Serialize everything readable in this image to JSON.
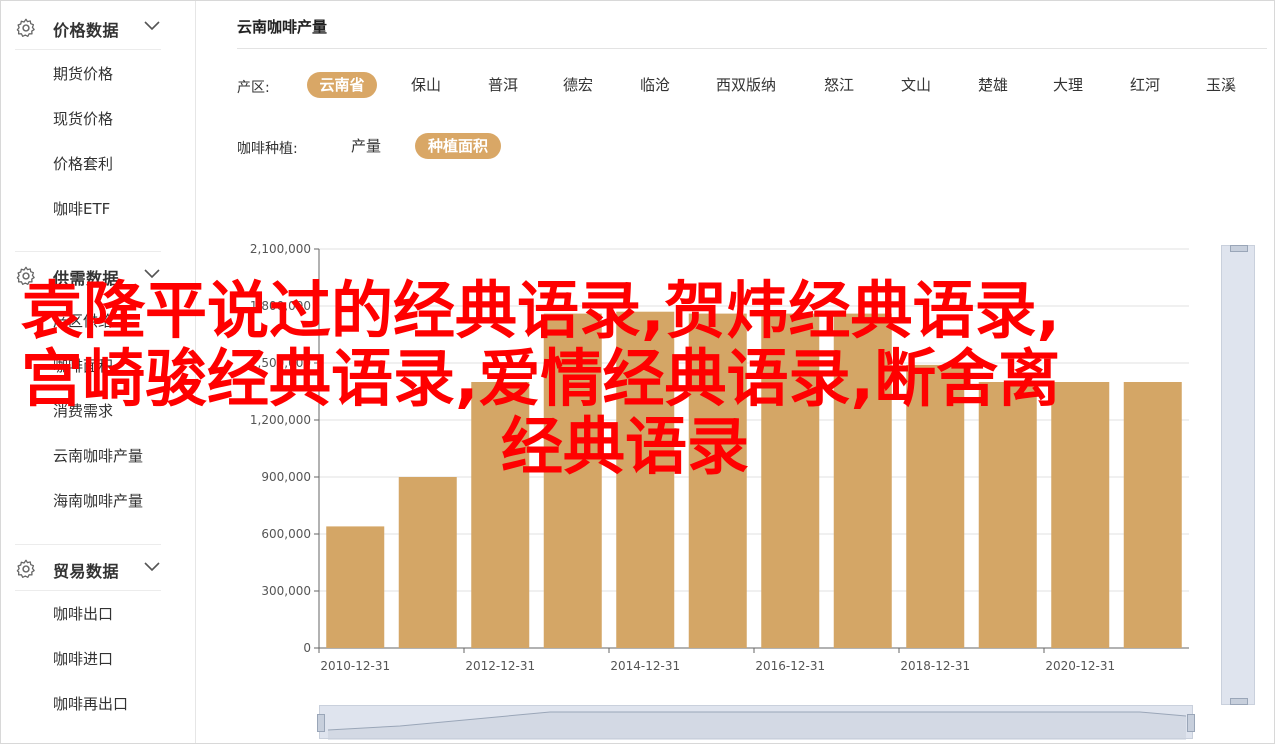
{
  "sidebar": {
    "groups": [
      {
        "title": "价格数据",
        "items": [
          "期货价格",
          "现货价格",
          "价格套利",
          "咖啡ETF"
        ]
      },
      {
        "title": "供需数据",
        "items": [
          "产区供给",
          "咖啡面积",
          "消费需求",
          "云南咖啡产量",
          "海南咖啡产量"
        ]
      },
      {
        "title": "贸易数据",
        "items": [
          "咖啡出口",
          "咖啡进口",
          "咖啡再出口"
        ]
      }
    ]
  },
  "main": {
    "title": "云南咖啡产量",
    "region_label": "产区:",
    "regions": [
      "云南省",
      "保山",
      "普洱",
      "德宏",
      "临沧",
      "西双版纳",
      "怒江",
      "文山",
      "楚雄",
      "大理",
      "红河",
      "玉溪"
    ],
    "active_region": 0,
    "type_label": "咖啡种植:",
    "types": [
      "产量",
      "种植面积"
    ],
    "active_type": 1
  },
  "chart_data": {
    "type": "bar",
    "x": [
      "2010-12-31",
      "2011-12-31",
      "2012-12-31",
      "2013-12-31",
      "2014-12-31",
      "2015-12-31",
      "2016-12-31",
      "2017-12-31",
      "2018-12-31",
      "2019-12-31",
      "2020-12-31",
      "2021-12-31"
    ],
    "values": [
      640000,
      900000,
      1400000,
      1760000,
      1770000,
      1760000,
      1760000,
      1760000,
      1490000,
      1400000,
      1400000,
      1400000
    ],
    "xticks": [
      "2010-12-31",
      "2012-12-31",
      "2014-12-31",
      "2016-12-31",
      "2018-12-31",
      "2020-12-31"
    ],
    "yticks": [
      "0",
      "300,000",
      "600,000",
      "900,000",
      "1,200,000",
      "1,500,000",
      "1,800,000",
      "2,100,000"
    ],
    "ylim": [
      0,
      2100000
    ],
    "grid": true,
    "bar_color": "#d4a666"
  },
  "overlay": {
    "line1": "袁隆平说过的经典语录,贺炜经典语录,",
    "line2": "宫崎骏经典语录,爱情经典语录,断舍离",
    "line3": "经典语录"
  },
  "colors": {
    "accent": "#d9a766",
    "overlay_text": "#ff0000"
  }
}
